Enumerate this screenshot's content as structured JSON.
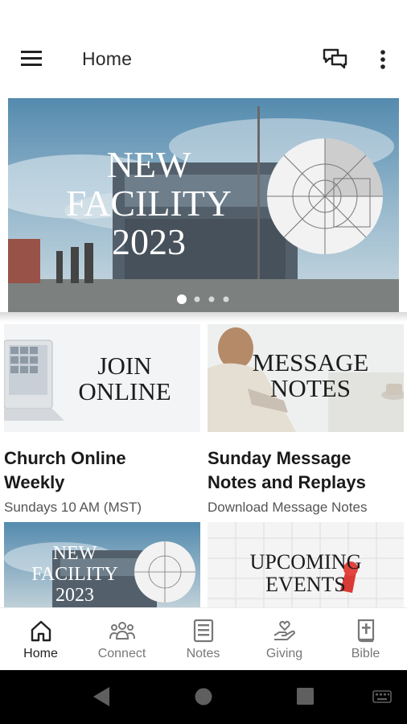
{
  "header": {
    "title": "Home",
    "menu_icon": "hamburger-menu-icon",
    "chat_icon": "chat-bubbles-icon",
    "more_icon": "more-vertical-icon"
  },
  "carousel": {
    "slide_text": [
      "NEW",
      "FACILITY",
      "2023"
    ],
    "page_count": 4,
    "current_page": 1
  },
  "cards": [
    {
      "thumb_text": [
        "JOIN",
        "ONLINE"
      ],
      "title_line1": "Church Online",
      "title_line2": "Weekly",
      "subtitle": "Sundays 10 AM (MST)"
    },
    {
      "thumb_text": [
        "MESSAGE",
        "NOTES"
      ],
      "title_line1": "Sunday Message",
      "title_line2": "Notes and Replays",
      "subtitle": "Download Message Notes"
    },
    {
      "thumb_text": [
        "NEW",
        "FACILITY",
        "2023"
      ]
    },
    {
      "thumb_text": [
        "UPCOMING",
        "EVENTS"
      ]
    }
  ],
  "bottom_nav": [
    {
      "label": "Home",
      "icon": "home-icon",
      "active": true
    },
    {
      "label": "Connect",
      "icon": "people-group-icon",
      "active": false
    },
    {
      "label": "Notes",
      "icon": "notes-icon",
      "active": false
    },
    {
      "label": "Giving",
      "icon": "giving-hand-heart-icon",
      "active": false
    },
    {
      "label": "Bible",
      "icon": "bible-icon",
      "active": false
    }
  ],
  "system_nav": {
    "back_icon": "back-triangle-icon",
    "home_icon": "home-circle-icon",
    "recents_icon": "recents-square-icon",
    "keyboard_icon": "keyboard-icon"
  }
}
